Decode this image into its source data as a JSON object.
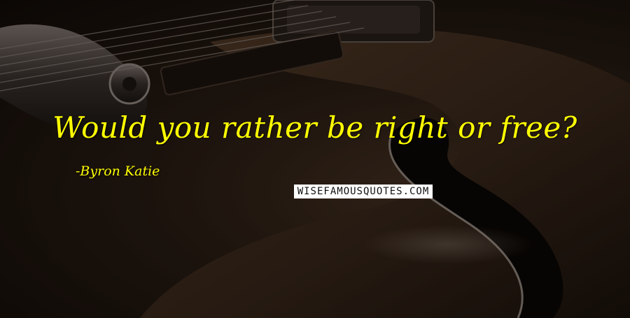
{
  "quote": {
    "text": "Would you rather be right or free?",
    "author": "Byron Katie",
    "color": "#ffff00"
  },
  "watermark": {
    "text": "WISEFAMOUSQUOTES.COM",
    "background": "#ffffff",
    "color": "#111111"
  },
  "background": {
    "subject": "guitar-photo",
    "base_color": "#2b1e14"
  }
}
